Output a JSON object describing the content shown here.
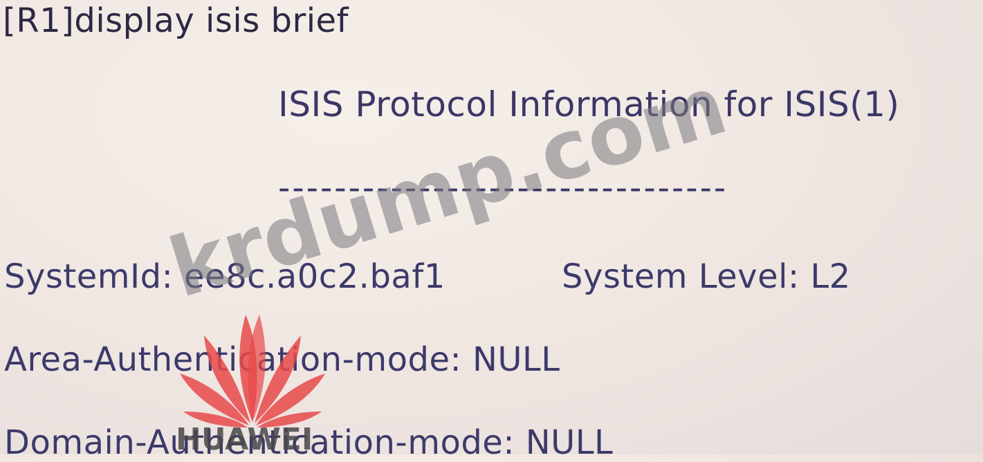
{
  "terminal": {
    "command": "[R1]display isis brief",
    "header": "ISIS Protocol Information for ISIS(1)",
    "separator": "--------------------------------",
    "system_id": "SystemId: ee8c.a0c2.baf1",
    "system_level": "System Level: L2",
    "area_auth": "Area-Authentication-mode: NULL",
    "domain_auth": "Domain-Authentication-mode: NULL"
  },
  "watermark": {
    "site": "krdump.com",
    "logo_text": "HUAWEI",
    "site_color": "#787880",
    "logo_color": "#e8494a"
  }
}
